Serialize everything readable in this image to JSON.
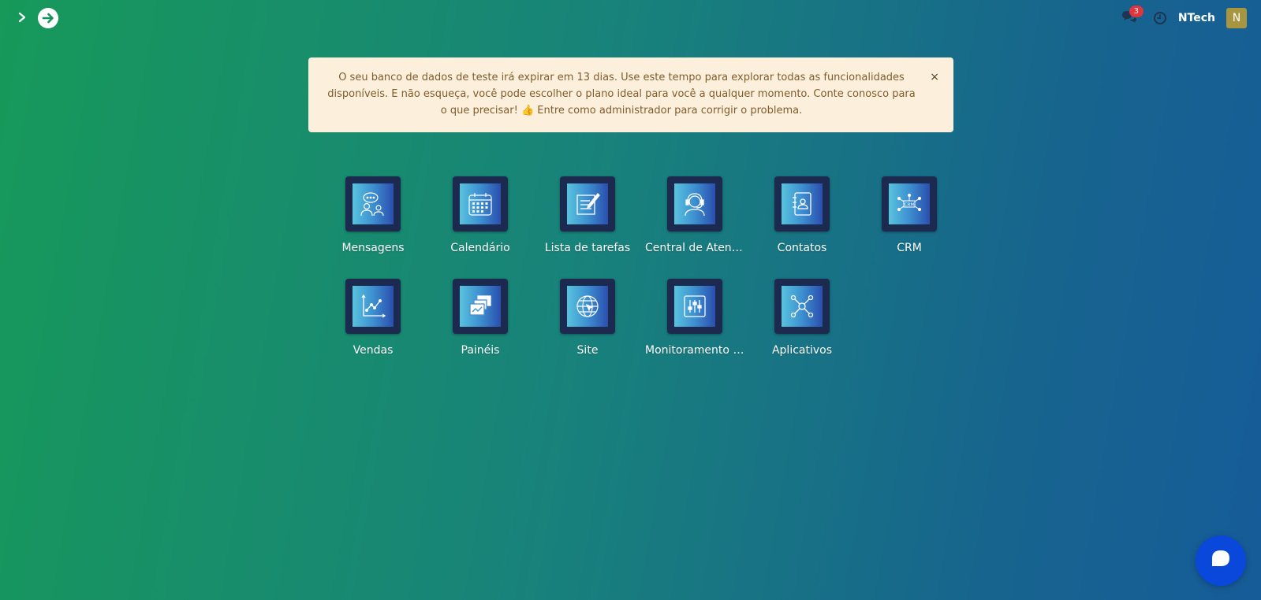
{
  "header": {
    "company_name": "NTech",
    "avatar_initial": "N",
    "chat_badge": "3",
    "icons": [
      "chevron-right-icon",
      "arrow-right-circle-icon",
      "chat-bubbles-icon",
      "clock-icon"
    ]
  },
  "alert": {
    "message": "O seu banco de dados de teste irá expirar em 13 dias. Use este tempo para explorar todas as funcionalidades disponíveis. E não esqueça, você pode escolher o plano ideal para você a qualquer momento. Conte conosco para o que precisar! 👍 Entre como administrador para corrigir o problema.",
    "close": "×"
  },
  "apps": [
    {
      "label": "Mensagens",
      "icon": "chat-people-icon"
    },
    {
      "label": "Calendário",
      "icon": "calendar-icon"
    },
    {
      "label": "Lista de tarefas",
      "icon": "task-list-icon"
    },
    {
      "label": "Central de Atendimento",
      "icon": "headset-agent-icon"
    },
    {
      "label": "Contatos",
      "icon": "contacts-book-icon"
    },
    {
      "label": "CRM",
      "icon": "crm-icon"
    },
    {
      "label": "Vendas",
      "icon": "sales-chart-icon"
    },
    {
      "label": "Painéis",
      "icon": "dashboards-icon"
    },
    {
      "label": "Site",
      "icon": "globe-icon"
    },
    {
      "label": "Monitoramento de Sistemas",
      "icon": "monitoring-sliders-icon"
    },
    {
      "label": "Aplicativos",
      "icon": "apps-network-icon"
    }
  ],
  "colors": {
    "bg_start": "#17995a",
    "bg_end": "#165c99",
    "alert_bg": "#fcefdc",
    "alert_text": "#815c2a",
    "badge": "#e0353d",
    "avatar": "#a8953f",
    "fab": "#0a48dc"
  }
}
